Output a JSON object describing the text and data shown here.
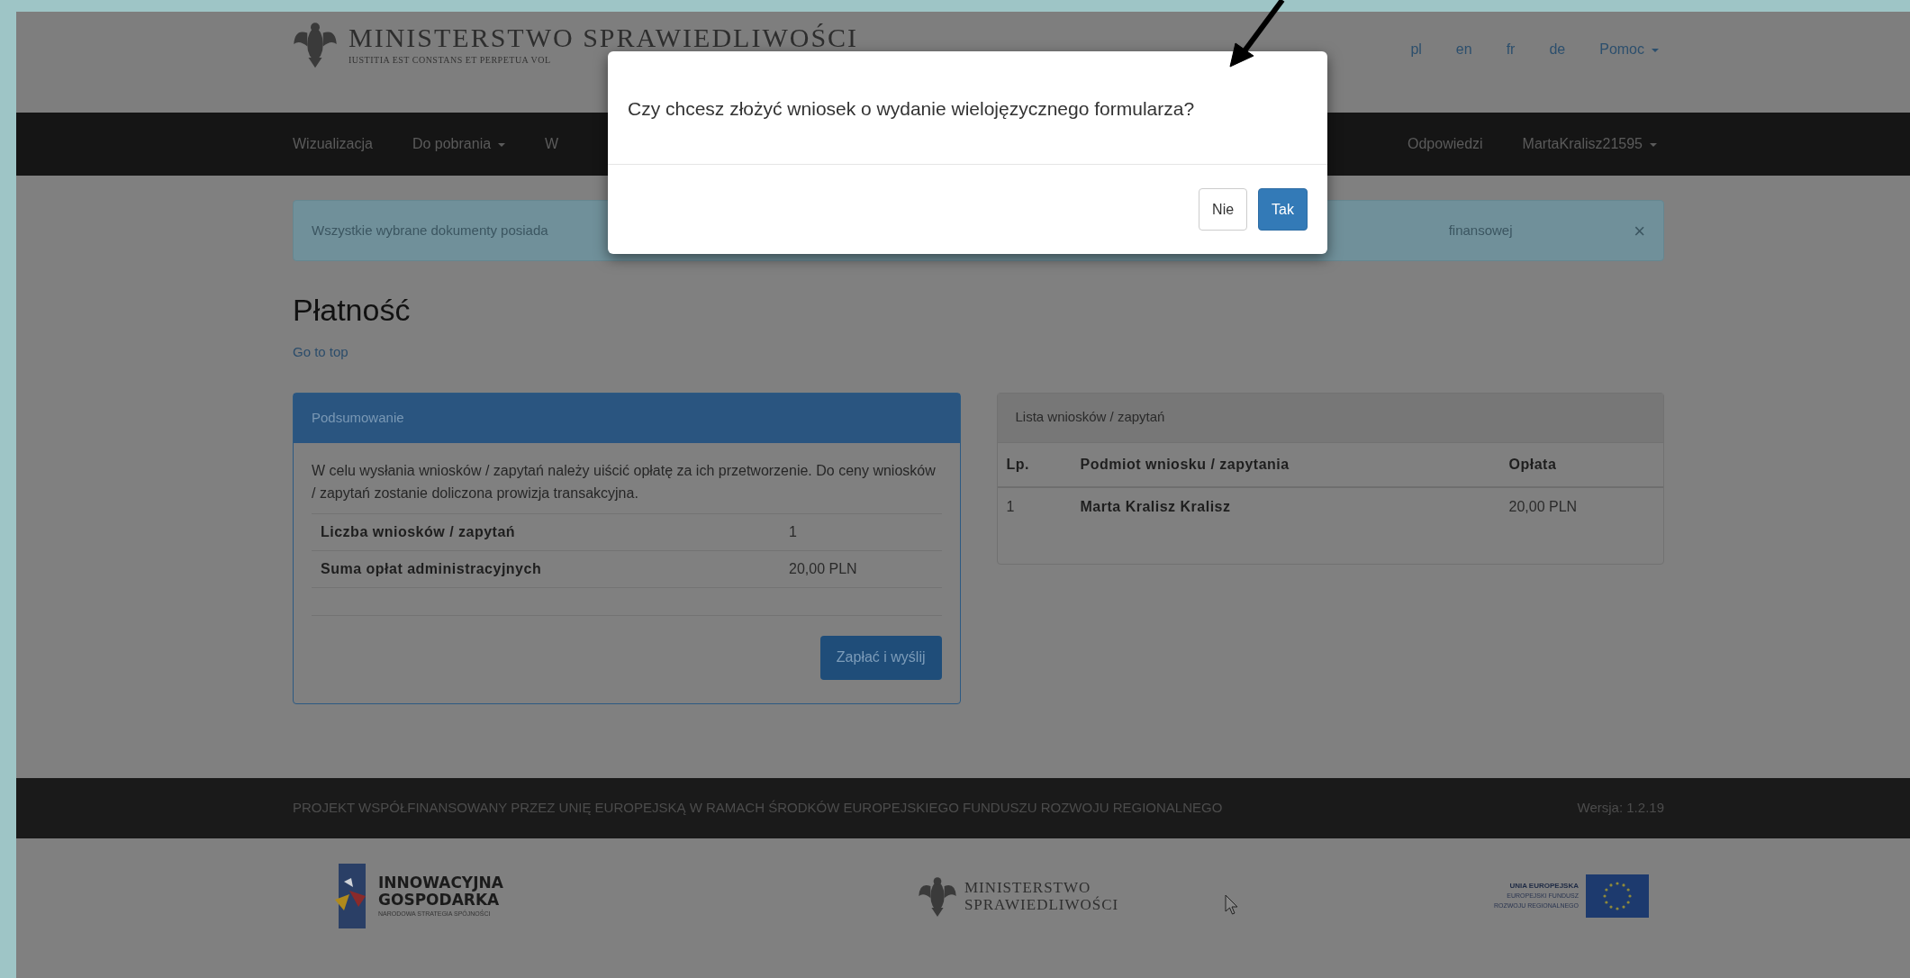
{
  "header": {
    "title": "MINISTERSTWO SPRAWIEDLIWOŚCI",
    "motto": "IUSTITIA EST CONSTANS ET PERPETUA VOL",
    "languages": [
      {
        "label": "pl"
      },
      {
        "label": "en"
      },
      {
        "label": "fr"
      },
      {
        "label": "de"
      }
    ],
    "help_menu": {
      "label": "Pomoc",
      "dropdown": true
    }
  },
  "navbar": {
    "left": [
      {
        "label": "Wizualizacja",
        "dropdown": false
      },
      {
        "label": "Do pobrania",
        "dropdown": true
      },
      {
        "label": "W",
        "dropdown": false
      }
    ],
    "right": [
      {
        "label": "Odpowiedzi",
        "dropdown": false
      },
      {
        "label": "MartaKralisz21595",
        "dropdown": true
      }
    ]
  },
  "alert": {
    "text_start": "Wszystkie wybrane dokumenty posiada",
    "text_end": "finansowej",
    "close": "×"
  },
  "page_title": "Płatność",
  "top_link": "Go to top",
  "summary_panel": {
    "title": "Podsumowanie",
    "description": "W celu wysłania wniosków / zapytań należy uiścić opłatę za ich przetworzenie. Do ceny wniosków / zapytań zostanie doliczona prowizja transakcyjna.",
    "rows": [
      {
        "label": "Liczba wniosków / zapytań",
        "value": "1"
      },
      {
        "label": "Suma opłat administracyjnych",
        "value": "20,00 PLN"
      }
    ],
    "button": "Zapłać i wyślij"
  },
  "list_panel": {
    "title": "Lista wniosków / zapytań",
    "columns": [
      "Lp.",
      "Podmiot wniosku / zapytania",
      "Opłata"
    ],
    "rows": [
      [
        "1",
        "Marta Kralisz Kralisz",
        "20,00 PLN"
      ]
    ]
  },
  "footer": {
    "notice": "PROJEKT WSPÓŁFINANSOWANY PRZEZ UNIĘ EUROPEJSKĄ W RAMACH ŚRODKÓW EUROPEJSKIEGO FUNDUSZU ROZWOJU REGIONALNEGO",
    "version": "Wersja: 1.2.19",
    "logo_innovation": [
      "INNOWACYJNA",
      "GOSPODARKA",
      "NARODOWA STRATEGIA SPÓJNOŚCI"
    ],
    "logo_ministry": [
      "MINISTERSTWO",
      "SPRAWIEDLIWOŚCI"
    ],
    "logo_eu": [
      "UNIA EUROPEJSKA",
      "EUROPEJSKI FUNDUSZ",
      "ROZWOJU REGIONALNEGO"
    ]
  },
  "dialog": {
    "question": "Czy chcesz złożyć wniosek o wydanie wielojęzycznego formularza?",
    "buttons": [
      {
        "label": "Nie",
        "primary": false
      },
      {
        "label": "Tak",
        "primary": true
      }
    ]
  }
}
